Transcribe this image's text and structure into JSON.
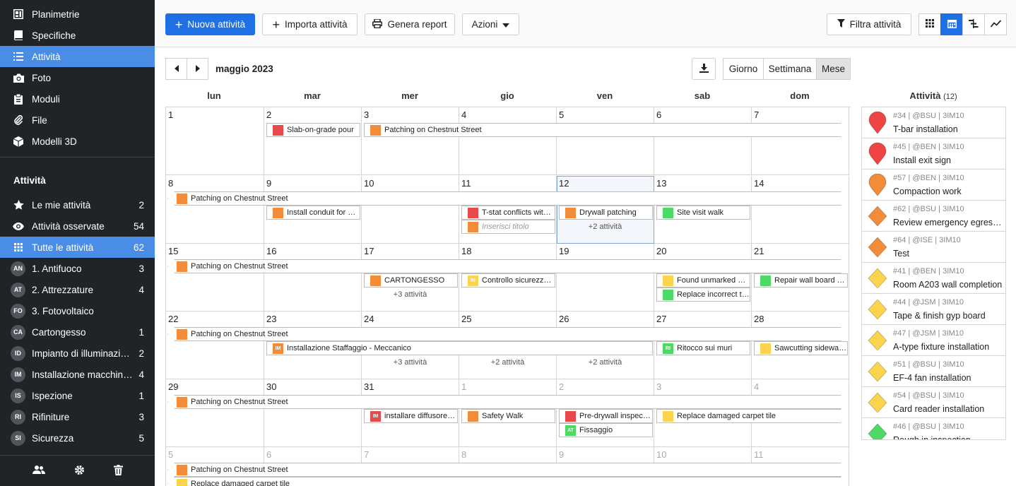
{
  "sidebar": {
    "top_items": [
      {
        "label": "Planimetrie",
        "icon": "map-icon"
      },
      {
        "label": "Specifiche",
        "icon": "book-icon"
      },
      {
        "label": "Attività",
        "icon": "list-icon"
      },
      {
        "label": "Foto",
        "icon": "camera-icon"
      },
      {
        "label": "Moduli",
        "icon": "clipboard-icon"
      },
      {
        "label": "File",
        "icon": "paperclip-icon"
      },
      {
        "label": "Modelli 3D",
        "icon": "cube-icon"
      }
    ],
    "section_title": "Attività",
    "filters": [
      {
        "label": "Le mie attività",
        "count": "2",
        "icon": "star-icon"
      },
      {
        "label": "Attività osservate",
        "count": "54",
        "icon": "eye-icon"
      },
      {
        "label": "Tutte le attività",
        "count": "62",
        "icon": "grid-icon"
      }
    ],
    "categories": [
      {
        "abbr": "AN",
        "label": "1. Antifuoco",
        "count": "3"
      },
      {
        "abbr": "AT",
        "label": "2. Attrezzature",
        "count": "4"
      },
      {
        "abbr": "FO",
        "label": "3. Fotovoltaico",
        "count": ""
      },
      {
        "abbr": "CA",
        "label": "Cartongesso",
        "count": "1"
      },
      {
        "abbr": "ID",
        "label": "Impianto di illuminazi…",
        "count": "2"
      },
      {
        "abbr": "IM",
        "label": "Installazione macchin…",
        "count": "4"
      },
      {
        "abbr": "IS",
        "label": "Ispezione",
        "count": "1"
      },
      {
        "abbr": "RI",
        "label": "Rifiniture",
        "count": "3"
      },
      {
        "abbr": "SI",
        "label": "Sicurezza",
        "count": "5"
      }
    ]
  },
  "toolbar": {
    "new_label": "Nuova attività",
    "import_label": "Importa attività",
    "report_label": "Genera report",
    "actions_label": "Azioni",
    "filter_label": "Filtra attività"
  },
  "calendar": {
    "month_label": "maggio 2023",
    "view_day": "Giorno",
    "view_week": "Settimana",
    "view_month": "Mese",
    "weekdays": [
      "lun",
      "mar",
      "mer",
      "gio",
      "ven",
      "sab",
      "dom"
    ],
    "weeks": [
      [
        {
          "d": "1"
        },
        {
          "d": "2"
        },
        {
          "d": "3"
        },
        {
          "d": "4"
        },
        {
          "d": "5"
        },
        {
          "d": "6"
        },
        {
          "d": "7"
        }
      ],
      [
        {
          "d": "8"
        },
        {
          "d": "9"
        },
        {
          "d": "10"
        },
        {
          "d": "11"
        },
        {
          "d": "12",
          "today": true
        },
        {
          "d": "13"
        },
        {
          "d": "14"
        }
      ],
      [
        {
          "d": "15"
        },
        {
          "d": "16"
        },
        {
          "d": "17"
        },
        {
          "d": "18"
        },
        {
          "d": "19"
        },
        {
          "d": "20"
        },
        {
          "d": "21"
        }
      ],
      [
        {
          "d": "22"
        },
        {
          "d": "23"
        },
        {
          "d": "24"
        },
        {
          "d": "25"
        },
        {
          "d": "26"
        },
        {
          "d": "27"
        },
        {
          "d": "28"
        }
      ],
      [
        {
          "d": "29"
        },
        {
          "d": "30"
        },
        {
          "d": "31"
        },
        {
          "d": "1",
          "other": true
        },
        {
          "d": "2",
          "other": true
        },
        {
          "d": "3",
          "other": true
        },
        {
          "d": "4",
          "other": true
        }
      ],
      [
        {
          "d": "5",
          "other": true
        },
        {
          "d": "6",
          "other": true
        },
        {
          "d": "7",
          "other": true
        },
        {
          "d": "8",
          "other": true
        },
        {
          "d": "9",
          "other": true
        },
        {
          "d": "10",
          "other": true
        },
        {
          "d": "11",
          "other": true
        }
      ]
    ],
    "events": [
      {
        "week": 0,
        "start": 1,
        "span": 1,
        "row": 0,
        "label": "Slab-on-grade pour",
        "color": "#e84a4a"
      },
      {
        "week": 0,
        "start": 2,
        "span": 5,
        "row": 0,
        "label": "Patching on Chestnut Street",
        "color": "#f28c38",
        "cont_right": true
      },
      {
        "week": 1,
        "start": 0,
        "span": 7,
        "row": 0,
        "label": "Patching on Chestnut Street",
        "color": "#f28c38",
        "cont_left": true,
        "cont_right": true
      },
      {
        "week": 1,
        "start": 1,
        "span": 1,
        "row": 1,
        "label": "Install conduit for …",
        "color": "#f28c38"
      },
      {
        "week": 1,
        "start": 3,
        "span": 1,
        "row": 1,
        "label": "T-stat conflicts wit…",
        "color": "#e84a4a"
      },
      {
        "week": 1,
        "start": 3,
        "span": 1,
        "row": 2,
        "label": "Inserisci titolo",
        "color": "#f28c38",
        "placeholder": true
      },
      {
        "week": 1,
        "start": 4,
        "span": 1,
        "row": 1,
        "label": "Drywall patching",
        "color": "#f28c38"
      },
      {
        "week": 1,
        "start": 5,
        "span": 1,
        "row": 1,
        "label": "Site visit walk",
        "color": "#4cd964"
      },
      {
        "week": 2,
        "start": 0,
        "span": 7,
        "row": 0,
        "label": "Patching on Chestnut Street",
        "color": "#f28c38",
        "cont_left": true,
        "cont_right": true
      },
      {
        "week": 2,
        "start": 2,
        "span": 1,
        "row": 1,
        "label": "CARTONGESSO",
        "color": "#f28c38"
      },
      {
        "week": 2,
        "start": 3,
        "span": 1,
        "row": 1,
        "label": "Controllo sicurezz…",
        "color": "#fcd34d",
        "abbr": "RI"
      },
      {
        "week": 2,
        "start": 5,
        "span": 1,
        "row": 1,
        "label": "Found unmarked u…",
        "color": "#fcd34d"
      },
      {
        "week": 2,
        "start": 5,
        "span": 1,
        "row": 2,
        "label": "Replace incorrect t…",
        "color": "#4cd964"
      },
      {
        "week": 2,
        "start": 6,
        "span": 1,
        "row": 1,
        "label": "Repair wall board o…",
        "color": "#4cd964"
      },
      {
        "week": 3,
        "start": 0,
        "span": 7,
        "row": 0,
        "label": "Patching on Chestnut Street",
        "color": "#f28c38",
        "cont_left": true,
        "cont_right": true
      },
      {
        "week": 3,
        "start": 1,
        "span": 4,
        "row": 1,
        "label": "Installazione Staffaggio - Meccanico",
        "color": "#f28c38",
        "abbr": "IM"
      },
      {
        "week": 3,
        "start": 5,
        "span": 1,
        "row": 1,
        "label": "Ritocco sui muri",
        "color": "#4cd964",
        "abbr": "RI"
      },
      {
        "week": 3,
        "start": 6,
        "span": 1,
        "row": 1,
        "label": "Sawcutting sidewal…",
        "color": "#fcd34d"
      },
      {
        "week": 4,
        "start": 0,
        "span": 7,
        "row": 0,
        "label": "Patching on Chestnut Street",
        "color": "#f28c38",
        "cont_left": true,
        "cont_right": true
      },
      {
        "week": 4,
        "start": 2,
        "span": 1,
        "row": 1,
        "label": "installare diffusore …",
        "color": "#e84a4a",
        "abbr": "IM"
      },
      {
        "week": 4,
        "start": 3,
        "span": 1,
        "row": 1,
        "label": "Safety Walk",
        "color": "#f28c38"
      },
      {
        "week": 4,
        "start": 4,
        "span": 1,
        "row": 1,
        "label": "Pre-drywall inspec…",
        "color": "#e84a4a"
      },
      {
        "week": 4,
        "start": 4,
        "span": 1,
        "row": 2,
        "label": "Fissaggio",
        "color": "#4cd964",
        "abbr": "AT"
      },
      {
        "week": 4,
        "start": 5,
        "span": 2,
        "row": 1,
        "label": "Replace damaged carpet tile",
        "color": "#fcd34d",
        "cont_right": true
      },
      {
        "week": 5,
        "start": 0,
        "span": 7,
        "row": 0,
        "label": "Patching on Chestnut Street",
        "color": "#f28c38",
        "cont_left": true,
        "cont_right": true
      },
      {
        "week": 5,
        "start": 0,
        "span": 7,
        "row": 1,
        "label": "Replace damaged carpet tile",
        "color": "#fcd34d",
        "cont_left": true,
        "cont_right": true
      }
    ],
    "more": [
      {
        "week": 1,
        "day": 4,
        "label": "+2 attività"
      },
      {
        "week": 2,
        "day": 2,
        "label": "+3 attività"
      },
      {
        "week": 3,
        "day": 2,
        "label": "+3 attività"
      },
      {
        "week": 3,
        "day": 3,
        "label": "+2 attività"
      },
      {
        "week": 3,
        "day": 4,
        "label": "+2 attività"
      }
    ]
  },
  "right_panel": {
    "title": "Attività",
    "count": "(12)",
    "items": [
      {
        "meta": "#34 | @BSU | 3IM10",
        "name": "T-bar installation",
        "shape": "pin",
        "color": "#ef4444"
      },
      {
        "meta": "#45 | @BEN | 3IM10",
        "name": "Install exit sign",
        "shape": "pin",
        "color": "#ef4444"
      },
      {
        "meta": "#57 | @BEN | 3IM10",
        "name": "Compaction work",
        "shape": "pin",
        "color": "#f28c38"
      },
      {
        "meta": "#62 | @BSU | 3IM10",
        "name": "Review emergency egress …",
        "shape": "diamond",
        "color": "#f28c38"
      },
      {
        "meta": "#64 | @ISE | 3IM10",
        "name": "Test",
        "shape": "diamond",
        "color": "#f28c38"
      },
      {
        "meta": "#41 | @BEN | 3IM10",
        "name": "Room A203 wall completion",
        "shape": "diamond",
        "color": "#fcd34d"
      },
      {
        "meta": "#44 | @JSM | 3IM10",
        "name": "Tape & finish gyp board",
        "shape": "diamond",
        "color": "#fcd34d"
      },
      {
        "meta": "#47 | @JSM | 3IM10",
        "name": "A-type fixture installation",
        "shape": "diamond",
        "color": "#fcd34d"
      },
      {
        "meta": "#51 | @BSU | 3IM10",
        "name": "EF-4 fan installation",
        "shape": "diamond",
        "color": "#fcd34d"
      },
      {
        "meta": "#54 | @BSU | 3IM10",
        "name": "Card reader installation",
        "shape": "diamond",
        "color": "#fcd34d"
      },
      {
        "meta": "#46 | @BSU | 3IM10",
        "name": "Rough in inspection",
        "shape": "diamond",
        "color": "#4cd964"
      }
    ]
  }
}
